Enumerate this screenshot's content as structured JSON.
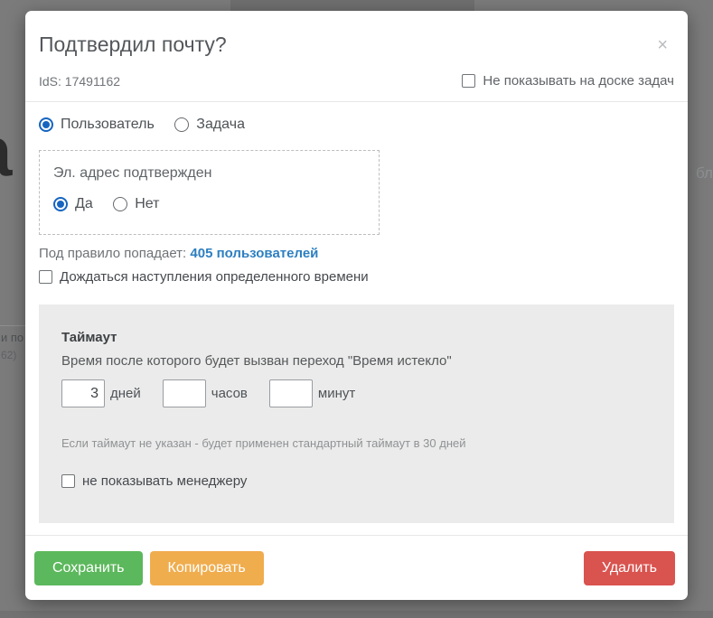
{
  "backdrop": {
    "heading_fragment": "а",
    "right_text_fragment": "бл",
    "table_fragment_line1": "и по",
    "table_fragment_line2": "62)"
  },
  "modal": {
    "title": "Подтвердил почту?",
    "id_text": "IdS: 17491162",
    "close_glyph": "×",
    "hide_on_board": {
      "label": "Не показывать на доске задач",
      "checked": false
    },
    "entity_type": {
      "options": [
        {
          "label": "Пользователь",
          "checked": true
        },
        {
          "label": "Задача",
          "checked": false
        }
      ]
    },
    "condition": {
      "title": "Эл. адрес подтвержден",
      "options": [
        {
          "label": "Да",
          "checked": true
        },
        {
          "label": "Нет",
          "checked": false
        }
      ]
    },
    "match": {
      "prefix": "Под правило попадает:",
      "link_text": "405 пользователей"
    },
    "wait_time": {
      "label": "Дождаться наступления определенного времени",
      "checked": false
    },
    "timeout": {
      "title": "Таймаут",
      "description": "Время после которого будет вызван переход \"Время истекло\"",
      "fields": [
        {
          "value": "3",
          "unit": "дней"
        },
        {
          "value": "",
          "unit": "часов"
        },
        {
          "value": "",
          "unit": "минут"
        }
      ],
      "note": "Если таймаут не указан - будет применен стандартный таймаут в 30 дней",
      "hide_from_manager": {
        "label": "не показывать менеджеру",
        "checked": false
      }
    },
    "footer": {
      "save": "Сохранить",
      "copy": "Копировать",
      "delete": "Удалить"
    }
  },
  "colors": {
    "accent_blue": "#1665c0",
    "link_blue": "#2d7fc1",
    "save_green": "#5cb85c",
    "copy_orange": "#f0ad4e",
    "delete_red": "#d9534f",
    "overlay_gray": "#7b7b7b"
  }
}
